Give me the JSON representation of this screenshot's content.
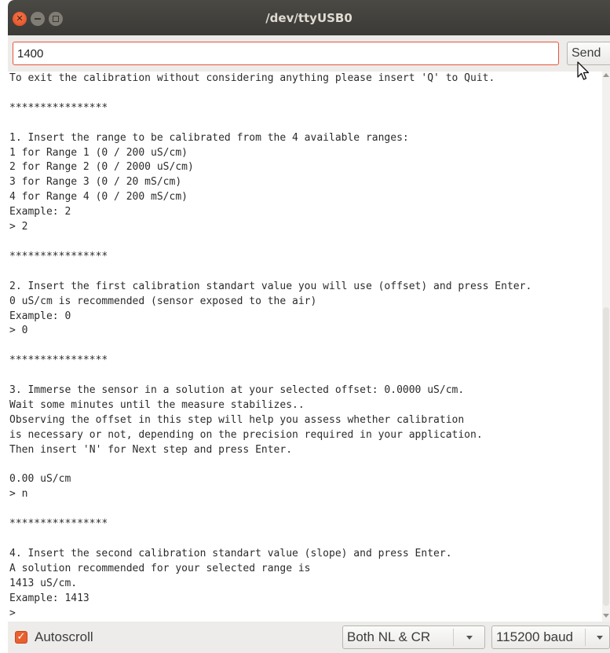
{
  "window": {
    "title": "/dev/ttyUSB0"
  },
  "send": {
    "input_value": "1400",
    "button_label": "Send"
  },
  "console": {
    "lines": [
      "To exit the calibration without considering anything please insert 'Q' to Quit.",
      "",
      "****************",
      "",
      "1. Insert the range to be calibrated from the 4 available ranges:",
      "1 for Range 1 (0 / 200 uS/cm)",
      "2 for Range 2 (0 / 2000 uS/cm)",
      "3 for Range 3 (0 / 20 mS/cm)",
      "4 for Range 4 (0 / 200 mS/cm)",
      "Example: 2",
      "> 2",
      "",
      "****************",
      "",
      "2. Insert the first calibration standart value you will use (offset) and press Enter.",
      "0 uS/cm is recommended (sensor exposed to the air)",
      "Example: 0",
      "> 0",
      "",
      "****************",
      "",
      "3. Immerse the sensor in a solution at your selected offset: 0.0000 uS/cm.",
      "Wait some minutes until the measure stabilizes..",
      "Observing the offset in this step will help you assess whether calibration",
      "is necessary or not, depending on the precision required in your application.",
      "Then insert 'N' for Next step and press Enter.",
      "",
      "0.00 uS/cm",
      "> n",
      "",
      "****************",
      "",
      "4. Insert the second calibration standart value (slope) and press Enter.",
      "A solution recommended for your selected range is",
      "1413 uS/cm.",
      "Example: 1413",
      ">"
    ]
  },
  "footer": {
    "autoscroll_label": "Autoscroll",
    "autoscroll_checked": true,
    "line_ending_selected": "Both NL & CR",
    "baud_selected": "115200 baud"
  },
  "colors": {
    "accent": "#e9602f",
    "titlebar": "#3b3a36",
    "input_border": "#e9553a"
  }
}
